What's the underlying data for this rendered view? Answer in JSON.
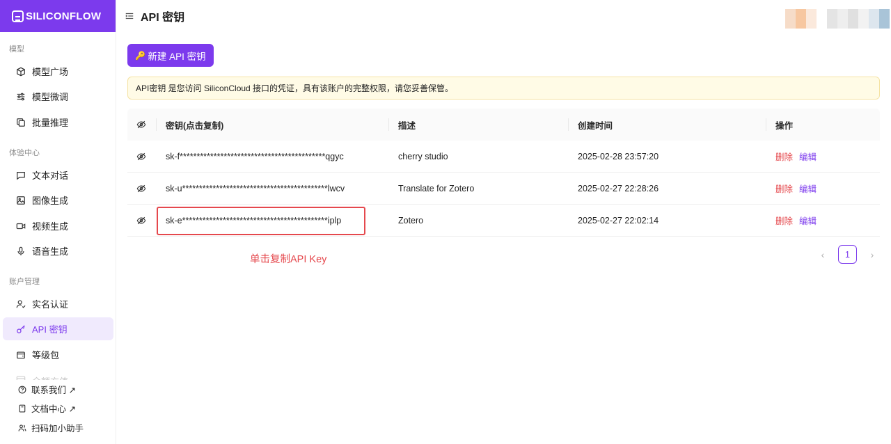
{
  "brand": {
    "name": "SILICONFLOW"
  },
  "header": {
    "title": "API 密钥"
  },
  "sidebar": {
    "sections": [
      {
        "title": "模型",
        "items": [
          {
            "label": "模型广场",
            "icon": "cube-icon"
          },
          {
            "label": "模型微调",
            "icon": "sliders-icon"
          },
          {
            "label": "批量推理",
            "icon": "copy-icon"
          }
        ]
      },
      {
        "title": "体验中心",
        "items": [
          {
            "label": "文本对话",
            "icon": "chat-icon"
          },
          {
            "label": "图像生成",
            "icon": "image-icon"
          },
          {
            "label": "视频生成",
            "icon": "video-icon"
          },
          {
            "label": "语音生成",
            "icon": "mic-icon"
          }
        ]
      },
      {
        "title": "账户管理",
        "items": [
          {
            "label": "实名认证",
            "icon": "user-check-icon"
          },
          {
            "label": "API 密钥",
            "icon": "key-icon",
            "active": true
          },
          {
            "label": "等级包",
            "icon": "wallet-icon"
          },
          {
            "label": "余额充值",
            "icon": "card-icon"
          }
        ]
      }
    ],
    "footer": [
      {
        "label": "联系我们 ↗",
        "icon": "help-icon"
      },
      {
        "label": "文档中心 ↗",
        "icon": "book-icon"
      },
      {
        "label": "扫码加小助手",
        "icon": "users-icon"
      }
    ]
  },
  "main": {
    "new_key_label": "新建 API 密钥",
    "notice": "API密钥 是您访问 SiliconCloud 接口的凭证，具有该账户的完整权限，请您妥善保管。",
    "table": {
      "headers": {
        "key": "密钥(点击复制)",
        "desc": "描述",
        "time": "创建时间",
        "actions": "操作"
      },
      "rows": [
        {
          "key": "sk-f*******************************************qgyc",
          "desc": "cherry studio",
          "time": "2025-02-28 23:57:20"
        },
        {
          "key": "sk-u*******************************************lwcv",
          "desc": "Translate for Zotero",
          "time": "2025-02-27 22:28:26"
        },
        {
          "key": "sk-e*******************************************iplp",
          "desc": "Zotero",
          "time": "2025-02-27 22:02:14"
        }
      ],
      "delete_label": "删除",
      "edit_label": "编辑"
    },
    "annotation": "单击复制API Key",
    "pagination": {
      "current": "1"
    }
  },
  "colors": {
    "accent": "#7c3aed",
    "danger": "#e5484d",
    "notice_bg": "#fffbe6"
  }
}
